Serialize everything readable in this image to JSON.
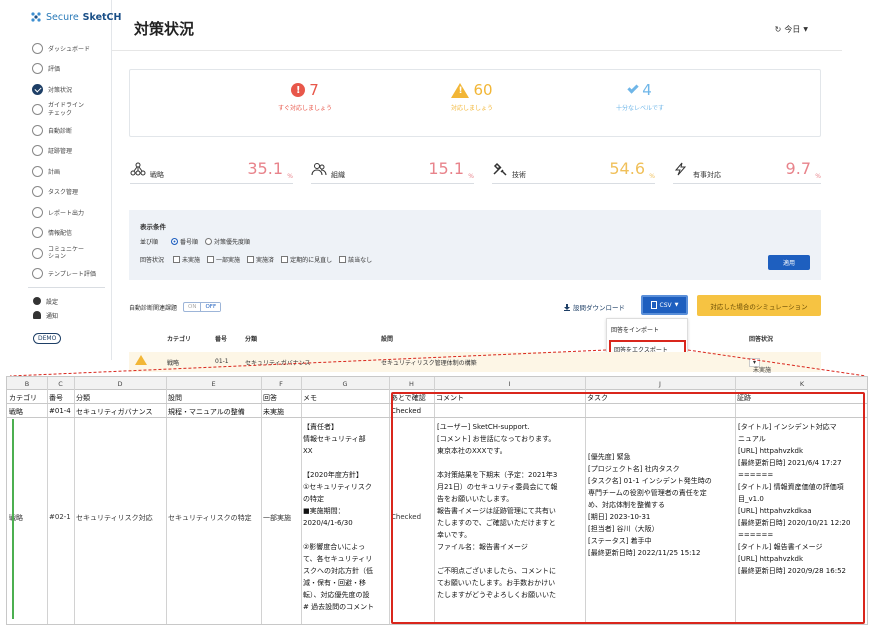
{
  "sidebar": {
    "logo_secure": "Secure",
    "logo_sketch": "SketCH",
    "items": [
      {
        "label": "ダッシュボード"
      },
      {
        "label": "評価"
      },
      {
        "label": "対策状況"
      },
      {
        "label1": "ガイドライン",
        "label2": "チェック"
      },
      {
        "label": "自動診断"
      },
      {
        "label": "証跡管理"
      },
      {
        "label": "計画"
      },
      {
        "label": "タスク管理"
      },
      {
        "label": "レポート出力"
      },
      {
        "label": "情報配信"
      },
      {
        "label1": "コミュニケー",
        "label2": "ション"
      },
      {
        "label": "テンプレート評価"
      }
    ],
    "settings": "設定",
    "notifications": "通知",
    "demo": "DEMO"
  },
  "header": {
    "title": "対策状況",
    "today": "今日"
  },
  "summary": [
    {
      "value": "7",
      "desc": "すぐ対応しましょう",
      "color": "#e8574a"
    },
    {
      "value": "60",
      "desc": "対応しましょう",
      "color": "#f2b636"
    },
    {
      "value": "4",
      "desc": "十分なレベルです",
      "color": "#6fb6e8"
    }
  ],
  "metrics": [
    {
      "label": "戦略",
      "value": "35.1",
      "unit": "%"
    },
    {
      "label": "組織",
      "value": "15.1",
      "unit": "%"
    },
    {
      "label": "技術",
      "value": "54.6",
      "unit": "%"
    },
    {
      "label": "有事対応",
      "value": "9.7",
      "unit": "%"
    }
  ],
  "conditions": {
    "title": "表示条件",
    "sort_label": "並び順",
    "sort_options": [
      "番号順",
      "対策優先度順"
    ],
    "answer_label": "回答状況",
    "answer_options": [
      "未実施",
      "一部実施",
      "実施済",
      "定期的に見直し",
      "該当なし"
    ],
    "apply": "適用"
  },
  "actions": {
    "auto_label": "自動診断関連課題",
    "toggle_on": "ON",
    "toggle_off": "OFF",
    "download": "設問ダウンロード",
    "csv": "CSV",
    "simulation": "対応した場合のシミュレーション",
    "menu_import": "回答をインポート",
    "menu_export": "回答をエクスポート"
  },
  "table": {
    "headers": [
      "カテゴリ",
      "番号",
      "分類",
      "設問",
      "回答状況"
    ],
    "row": {
      "category": "戦略",
      "number": "01-1",
      "class": "セキュリティガバナンス",
      "question": "セキュリティリスク管理体制の構築",
      "status": "未実施"
    }
  },
  "sheet": {
    "col_letters": [
      "B",
      "C",
      "D",
      "E",
      "F",
      "G",
      "H",
      "I",
      "J",
      "K"
    ],
    "headers": [
      "カテゴリ",
      "番号",
      "分類",
      "設問",
      "回答",
      "メモ",
      "あとで確認",
      "コメント",
      "タスク",
      "証跡"
    ],
    "row1": [
      "戦略",
      "#01-4",
      "セキュリティガバナンス",
      "規程・マニュアルの整備",
      "未実施",
      "",
      "Checked",
      "",
      "",
      ""
    ],
    "row2": {
      "category": "戦略",
      "number": "#02-1",
      "class": "セキュリティリスク対応",
      "question": "セキュリティリスクの特定",
      "answer": "一部実施",
      "checked": "Checked",
      "memo": "【責任者】\n情報セキュリティ部\nXX\n\n【2020年度方針】\n①セキュリティリスク\nの特定\n■実施期間：\n2020/4/1-6/30\n\n②影響度合いによっ\nて、各セキュリティリ\nスクへの対応方針（低\n減・保有・回避・移\n転）、対応優先度の設\n# 過去設問のコメント",
      "comment": "[ユーザー] SketCH-support.\n[コメント] お世話になっております。\n東京本社のXXXです。\n\n本対策結果を下期末（予定：2021年3\n月21日）のセキュリティ委員会にて報\n告をお願いいたします。\n報告書イメージは証跡管理にて共有い\nたしますので、ご確認いただけますと\n幸いです。\nファイル名：報告書イメージ\n\nご不明点ございましたら、コメントに\nてお願いいたします。お手数おかけい\nたしますがどうぞよろしくお願いいた",
      "task": "[優先度] 緊急\n[プロジェクト名] 社内タスク\n[タスク名] 01-1 インシデント発生時の\n専門チームの役割や管理者の責任を定\nめ、対応体制を整備する\n[期日] 2023-10-31\n[担当者] 谷川（大阪）\n[ステータス] 着手中\n[最終更新日時] 2022/11/25 15:12",
      "evidence": "[タイトル] インシデント対応マ\nニュアル\n[URL] httpahvzkdk\n[最終更新日時] 2021/6/4 17:27\n======\n[タイトル] 情報資産価値の評価項\n目_v1.0\n[URL] httpahvzkdkaa\n[最終更新日時] 2020/10/21 12:20\n======\n[タイトル] 報告書イメージ\n[URL] httpahvzkdk\n[最終更新日時] 2020/9/28 16:52"
    }
  }
}
